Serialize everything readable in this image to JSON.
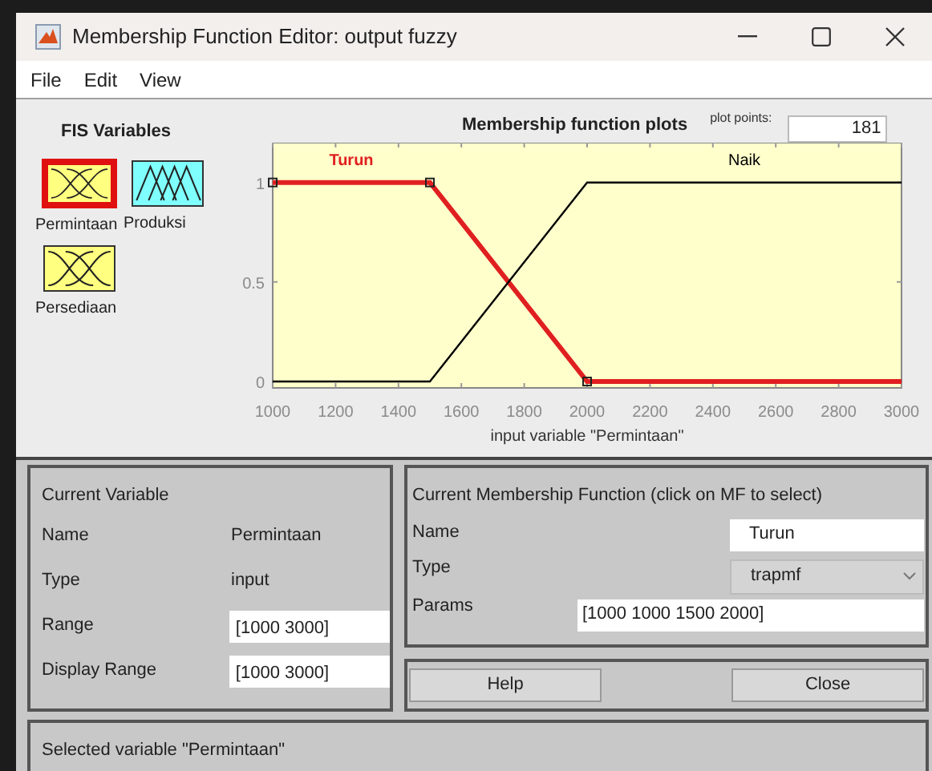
{
  "window": {
    "title": "Membership Function Editor: output fuzzy"
  },
  "menu": [
    "File",
    "Edit",
    "View"
  ],
  "fis_variables": {
    "title": "FIS Variables",
    "items": [
      {
        "name": "Permintaan",
        "selected": true,
        "color": "#ffff80"
      },
      {
        "name": "Produksi",
        "selected": false,
        "color": "#80ffff"
      },
      {
        "name": "Persediaan",
        "selected": false,
        "color": "#ffff80"
      }
    ]
  },
  "plot": {
    "plot_points_label": "plot points:",
    "plot_points": "181",
    "chart_data": {
      "type": "line",
      "title": "Membership function plots",
      "xlabel": "input variable \"Permintaan\"",
      "x": [
        1000,
        1500,
        2000,
        3000
      ],
      "series": [
        {
          "name": "Turun",
          "color": "#e02020",
          "values": [
            1,
            1,
            0,
            0
          ]
        },
        {
          "name": "Naik",
          "color": "#000000",
          "values": [
            0,
            0,
            1,
            1
          ]
        }
      ],
      "xlim": [
        1000,
        3000
      ],
      "ylim": [
        -0.032,
        1.2
      ],
      "xticks": [
        1000,
        1200,
        1400,
        1600,
        1800,
        2000,
        2200,
        2400,
        2600,
        2800,
        3000
      ],
      "yticks": [
        0,
        0.5,
        1
      ]
    }
  },
  "current_variable": {
    "title": "Current Variable",
    "rows": [
      {
        "label": "Name",
        "value": "Permintaan",
        "kind": "text"
      },
      {
        "label": "Type",
        "value": "input",
        "kind": "text"
      },
      {
        "label": "Range",
        "value": "[1000 3000]",
        "kind": "field"
      },
      {
        "label": "Display Range",
        "value": "[1000 3000]",
        "kind": "field"
      }
    ]
  },
  "current_mf": {
    "title": "Current Membership Function (click on MF to select)",
    "name_label": "Name",
    "name": "Turun",
    "type_label": "Type",
    "type": "trapmf",
    "params_label": "Params",
    "params": "[1000 1000 1500 2000]"
  },
  "buttons": [
    "Help",
    "Close"
  ],
  "status": "Selected variable \"Permintaan\""
}
